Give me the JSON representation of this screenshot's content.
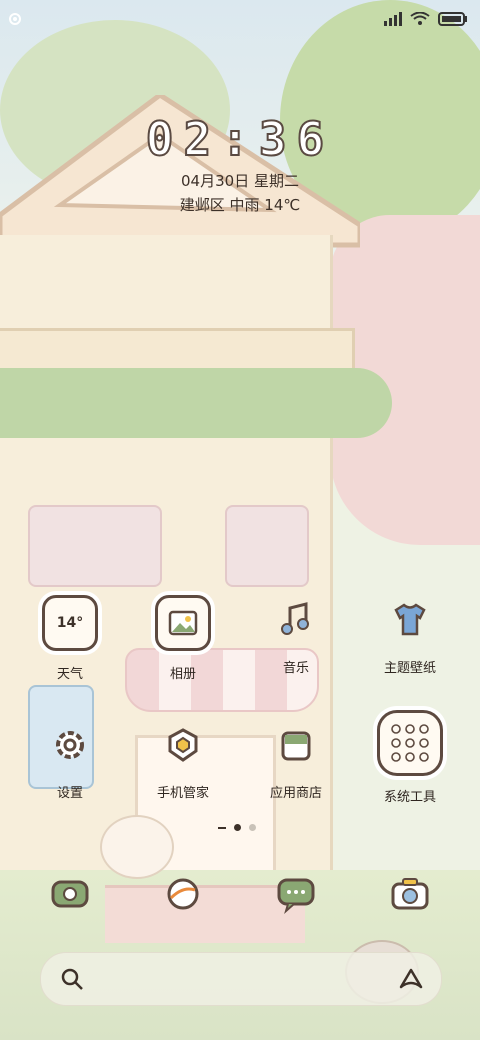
{
  "status": {
    "signal_icon": "signal-icon",
    "wifi_icon": "wifi-icon",
    "battery_icon": "battery-icon"
  },
  "clock": {
    "time": "02:36",
    "date": "04月30日 星期二",
    "weather": "建邺区 中雨 14℃"
  },
  "apps": [
    {
      "label": "天气",
      "icon": "weather-icon",
      "badge": "14°"
    },
    {
      "label": "相册",
      "icon": "gallery-icon"
    },
    {
      "label": "音乐",
      "icon": "music-icon"
    },
    {
      "label": "主题壁纸",
      "icon": "theme-icon"
    },
    {
      "label": "设置",
      "icon": "settings-icon"
    },
    {
      "label": "手机管家",
      "icon": "security-icon"
    },
    {
      "label": "应用商店",
      "icon": "app-store-icon"
    },
    {
      "label": "系统工具",
      "icon": "folder-icon"
    }
  ],
  "page_indicator": {
    "pages": 2,
    "current": 1
  },
  "dock": [
    {
      "icon": "phone-icon"
    },
    {
      "icon": "browser-icon"
    },
    {
      "icon": "messages-icon"
    },
    {
      "icon": "camera-icon"
    }
  ],
  "search": {
    "search_icon": "search-icon",
    "assistant_icon": "assistant-icon"
  },
  "colors": {
    "outline": "#5d4a40",
    "accent_green": "#8aa873",
    "accent_pink": "#f2d7d7"
  }
}
